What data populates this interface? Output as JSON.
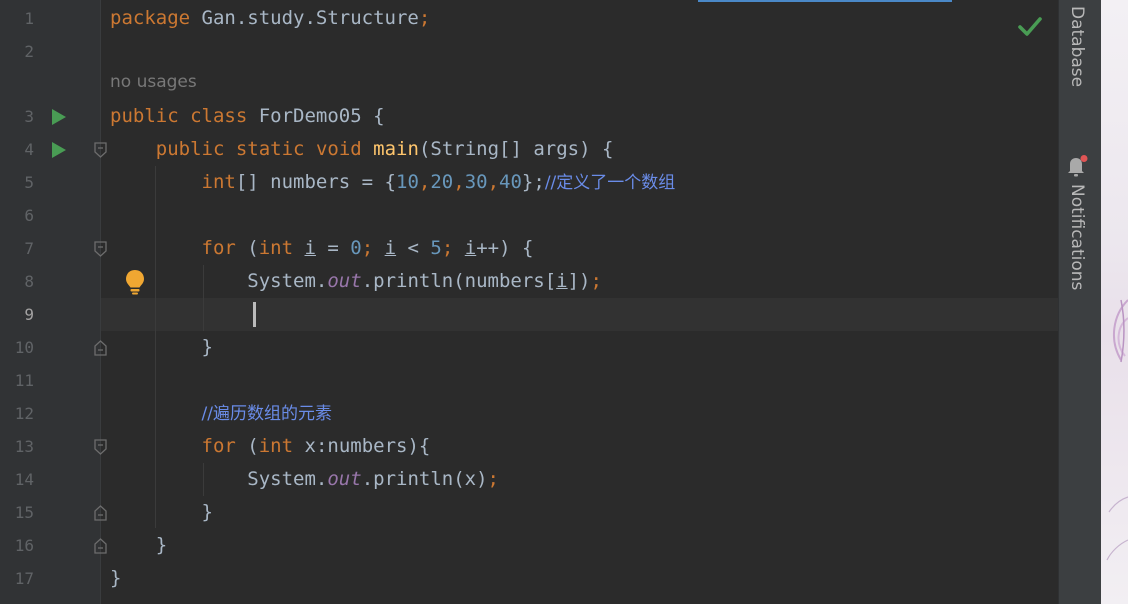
{
  "editor": {
    "usage_hint": "no usages",
    "gutter": [
      {
        "num": "1"
      },
      {
        "num": "2"
      },
      {
        "num": "3"
      },
      {
        "num": "4"
      },
      {
        "num": "5"
      },
      {
        "num": "6"
      },
      {
        "num": "7"
      },
      {
        "num": "8"
      },
      {
        "num": "9"
      },
      {
        "num": "10"
      },
      {
        "num": "11"
      },
      {
        "num": "12"
      },
      {
        "num": "13"
      },
      {
        "num": "14"
      },
      {
        "num": "15"
      },
      {
        "num": "16"
      },
      {
        "num": "17"
      }
    ],
    "active_line": "9",
    "code": {
      "l1": {
        "kw": "package",
        "rest": " Gan.study.Structure",
        "semi": ";"
      },
      "l3": {
        "kw1": "public",
        "kw2": "class",
        "name": " ForDemo05 {"
      },
      "l4": {
        "kw1": "public",
        "kw2": "static",
        "kw3": "void",
        "fn": "main",
        "rest": "(String[] args) {"
      },
      "l5": {
        "kw": "int",
        "rest": "[] numbers = {",
        "n1": "10",
        "n2": "20",
        "n3": "30",
        "n4": "40",
        "close": "};",
        "comment": "//定义了一个数组"
      },
      "l7": {
        "kw1": "for",
        "open": " (",
        "kw2": "int",
        "var1": "i",
        "eq": " = ",
        "zero": "0",
        "var2": "i",
        "lt": " < ",
        "five": "5",
        "var3": "i",
        "inc": "++) {"
      },
      "l8": {
        "sys": "System.",
        "out": "out",
        "call": ".println(numbers[",
        "var": "i",
        "end": "])"
      },
      "l10": {
        "text": "}"
      },
      "l12": {
        "comment": "//遍历数组的元素"
      },
      "l13": {
        "kw1": "for",
        "open": " (",
        "kw2": "int",
        "rest": " x:numbers){"
      },
      "l14": {
        "sys": "System.",
        "out": "out",
        "call": ".println(x)"
      },
      "l15": {
        "text": "}"
      },
      "l16": {
        "text": "}"
      },
      "l17": {
        "text": "}"
      }
    }
  },
  "side_panel": {
    "database_label": "Database",
    "notifications_label": "Notifications"
  },
  "icons": {
    "run": "run-gutter-icon",
    "fold": "fold-icon",
    "bulb": "intention-bulb-icon",
    "check": "inspection-ok-check-icon",
    "bell": "notification-bell-icon"
  },
  "colors": {
    "background": "#2b2b2b",
    "keyword": "#cc7832",
    "function": "#ffc66d",
    "number": "#6897bb",
    "comment": "#6a8ce8",
    "static_field": "#9876aa",
    "ok_check": "#499c54"
  }
}
